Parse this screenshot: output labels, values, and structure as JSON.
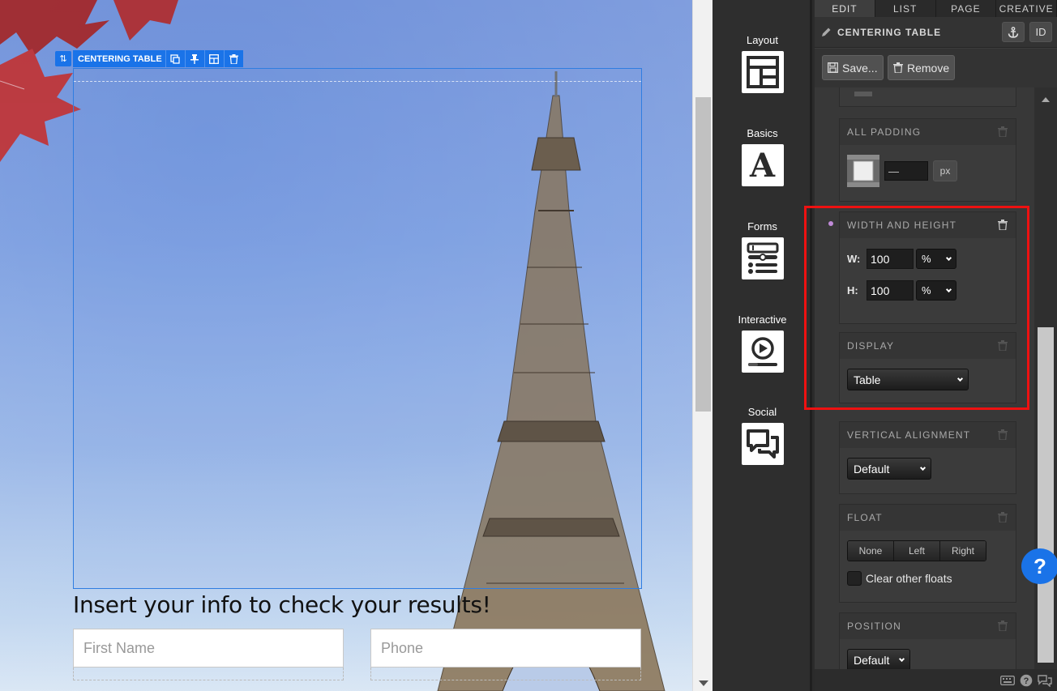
{
  "canvas": {
    "selected_element_label": "CENTERING TABLE",
    "form_title": "Insert your info to check your results!",
    "fields": [
      {
        "placeholder": "First Name"
      },
      {
        "placeholder": "Phone"
      }
    ]
  },
  "elements_panel": {
    "items": [
      {
        "label": "Layout",
        "icon": "layout-icon"
      },
      {
        "label": "Basics",
        "icon": "text-a-icon"
      },
      {
        "label": "Forms",
        "icon": "form-icon"
      },
      {
        "label": "Interactive",
        "icon": "play-icon"
      },
      {
        "label": "Social",
        "icon": "chat-icon"
      }
    ]
  },
  "panel": {
    "tabs": [
      "EDIT",
      "LIST",
      "PAGE",
      "CREATIVE"
    ],
    "active_tab": "EDIT",
    "title": "CENTERING TABLE",
    "id_button": "ID",
    "save_label": "Save...",
    "remove_label": "Remove",
    "all_padding": {
      "heading": "ALL PADDING",
      "value": "—",
      "unit": "px"
    },
    "width_height": {
      "heading": "WIDTH AND HEIGHT",
      "w_label": "W:",
      "w_value": "100",
      "w_unit": "%",
      "h_label": "H:",
      "h_value": "100",
      "h_unit": "%"
    },
    "display": {
      "heading": "DISPLAY",
      "value": "Table"
    },
    "vertical_alignment": {
      "heading": "VERTICAL ALIGNMENT",
      "value": "Default"
    },
    "float": {
      "heading": "FLOAT",
      "options": [
        "None",
        "Left",
        "Right"
      ],
      "clear_label": "Clear other floats"
    },
    "position": {
      "heading": "POSITION",
      "value": "Default"
    }
  },
  "colors": {
    "accent": "#1a73e8",
    "highlight": "#ee1111"
  }
}
